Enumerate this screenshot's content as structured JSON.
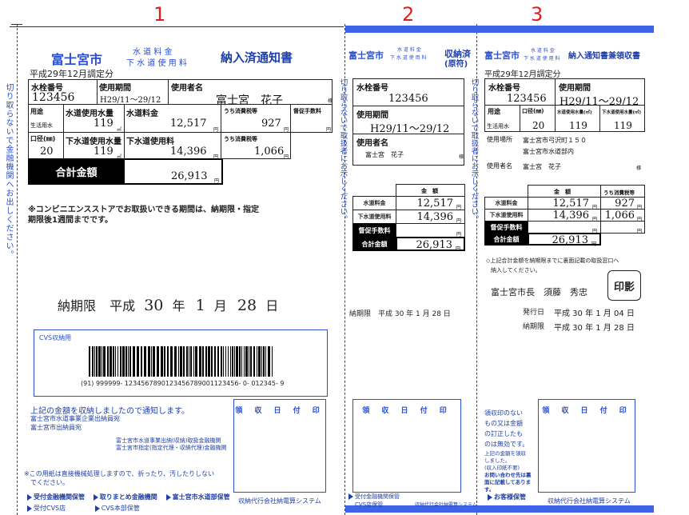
{
  "markers": {
    "m1": "1",
    "m2": "2",
    "m3": "3"
  },
  "cut_text": "切り取らないで金融機関へお出しください。",
  "cut_text2": "切り取らないで取扱者にお示しください。",
  "city": "富士宮市",
  "fee_top": "水 道 料 金",
  "fee_bottom": "下 水 道 使 用 料",
  "p1": {
    "title": "納入済通知書",
    "date_prefix": "平成29年12月調定分",
    "labels": {
      "account": "水栓番号",
      "period": "使用期間",
      "user": "使用者名",
      "use": "用途",
      "water_vol": "水道使用水量",
      "water_fee": "水道料金",
      "tax": "うち消費税等",
      "late": "督促手数料",
      "caliber": "口径(㎜)",
      "sewer_vol": "下水道使用水量",
      "sewer_fee": "下水道使用料",
      "tax2": "うち消費税等"
    },
    "values": {
      "account": "123456",
      "period": "H29/11～29/12",
      "user": "富士宮　花子",
      "sama": "様",
      "use": "生活用水",
      "water_vol": "119",
      "water_fee": "12,517",
      "tax": "927",
      "caliber": "20",
      "sewer_vol": "119",
      "sewer_fee": "14,396",
      "tax2": "1,066"
    },
    "units": {
      "m3": "㎥",
      "yen": "円"
    },
    "total_label": "合計金額",
    "total_value": "26,913",
    "note_l1": "※コンビニエンスストアでお取扱いできる期間は、納期限・指定",
    "note_l2": "期限後1週間までです。",
    "deadline_label": "納期限",
    "era": "平成",
    "year": "30",
    "month": "1",
    "day": "28",
    "nen": "年",
    "tsuki": "月",
    "hi": "日",
    "cvs_label": "CVS収納用",
    "barcode_text": "(91) 999999- 1234567890123456789001123456- 0- 012345- 9",
    "notify_1": "上記の金額を収納しましたので通知します。",
    "notify_2": "富士宮市水道事業企業出納員宛",
    "notify_3": "富士宮市出納員宛",
    "bank_1": "富士宮市水道事業出納(収納)取扱金融機関",
    "bank_2": "富士宮市指定(指定代理・収納代理)金融機関",
    "warn_1": "※この用紙は直接機械処理しますので、折ったり、汚したりしない",
    "warn_2": "でください。",
    "footer_1": "受付金融機関保管",
    "footer_2": "取りまとめ金融機関",
    "footer_3": "富士宮市水道部保管",
    "footer_4": "受付CVS店",
    "footer_5": "CVS本部保管",
    "stamp": "領 収 日 付 印",
    "agent": "収納代行会社納電算システム"
  },
  "p2": {
    "title": "収納済",
    "title_sub": "(原符)",
    "account_label": "水栓番号",
    "account": "123456",
    "period_label": "使用期間",
    "period": "H29/11～29/12",
    "user_label": "使用者名",
    "user": "富士宮　花子",
    "sama": "様",
    "amount_header": "金　額",
    "rows": [
      {
        "label": "水道料金",
        "value": "12,517",
        "unit": "円"
      },
      {
        "label": "下水道使用料",
        "value": "14,396",
        "unit": "円"
      },
      {
        "label": "督促手数料",
        "value": "",
        "unit": "円"
      },
      {
        "label": "合計金額",
        "value": "26,913",
        "unit": "円"
      }
    ],
    "deadline": "納期限　平成 30 年 1 月 28 日",
    "stamp": "領 収 日 付 印",
    "footer_1": "受付金融機関保管",
    "footer_2": "CVS店保管",
    "agent": "収納代行会社納電算システム"
  },
  "p3": {
    "title": "納入通知書兼領収書",
    "date_prefix": "平成29年12月調定分",
    "account_label": "水栓番号",
    "account": "123456",
    "period_label": "使用期間",
    "period": "H29/11～29/12",
    "use_label": "用途",
    "caliber_label": "口径(㎜)",
    "water_vol_label": "水道使用水量(㎥)",
    "sewer_vol_label": "下水道使用水量(㎥)",
    "use": "生活用水",
    "caliber": "20",
    "water_vol": "119",
    "sewer_vol": "119",
    "place_label": "使用場所",
    "place_1": "富士宮市弓沢町１５０",
    "place_2": "富士宮市水道部内",
    "user_label": "使用者名",
    "user": "富士宮　花子",
    "sama": "様",
    "amount_header": "金　額",
    "tax_header": "うち消費税等",
    "rows": [
      {
        "label": "水道料金",
        "value": "12,517",
        "tax": "927"
      },
      {
        "label": "下水道使用料",
        "value": "14,396",
        "tax": "1,066"
      },
      {
        "label": "督促手数料",
        "value": "",
        "tax": ""
      },
      {
        "label": "合計金額",
        "value": "26,913",
        "tax": ""
      }
    ],
    "unit": "円",
    "note_1": "◇上記合計金額を納期限までに裏面記載の取扱窓口へ",
    "note_2": "納入してください。",
    "mayor": "富士宮市長　須藤　秀忠",
    "seal": "印影",
    "issue_label": "発行日",
    "issue": "平成 30 年 1 月 04 日",
    "deadline_label": "納期限",
    "deadline": "平成 30 年 1 月 28 日",
    "side_1": "領収印のない",
    "side_2": "もの又は金額",
    "side_3": "の訂正したも",
    "side_4": "のは無効です。",
    "side_5": "上記の金額を領収",
    "side_6": "しました。",
    "side_7": "(収入印紙不要)",
    "side_8": "お問い合わせ先は裏",
    "side_9": "面に記載してあります。",
    "stamp": "領 収 日 付 印",
    "footer": "お客様保管",
    "agent": "収納代行会社納電算システム"
  }
}
